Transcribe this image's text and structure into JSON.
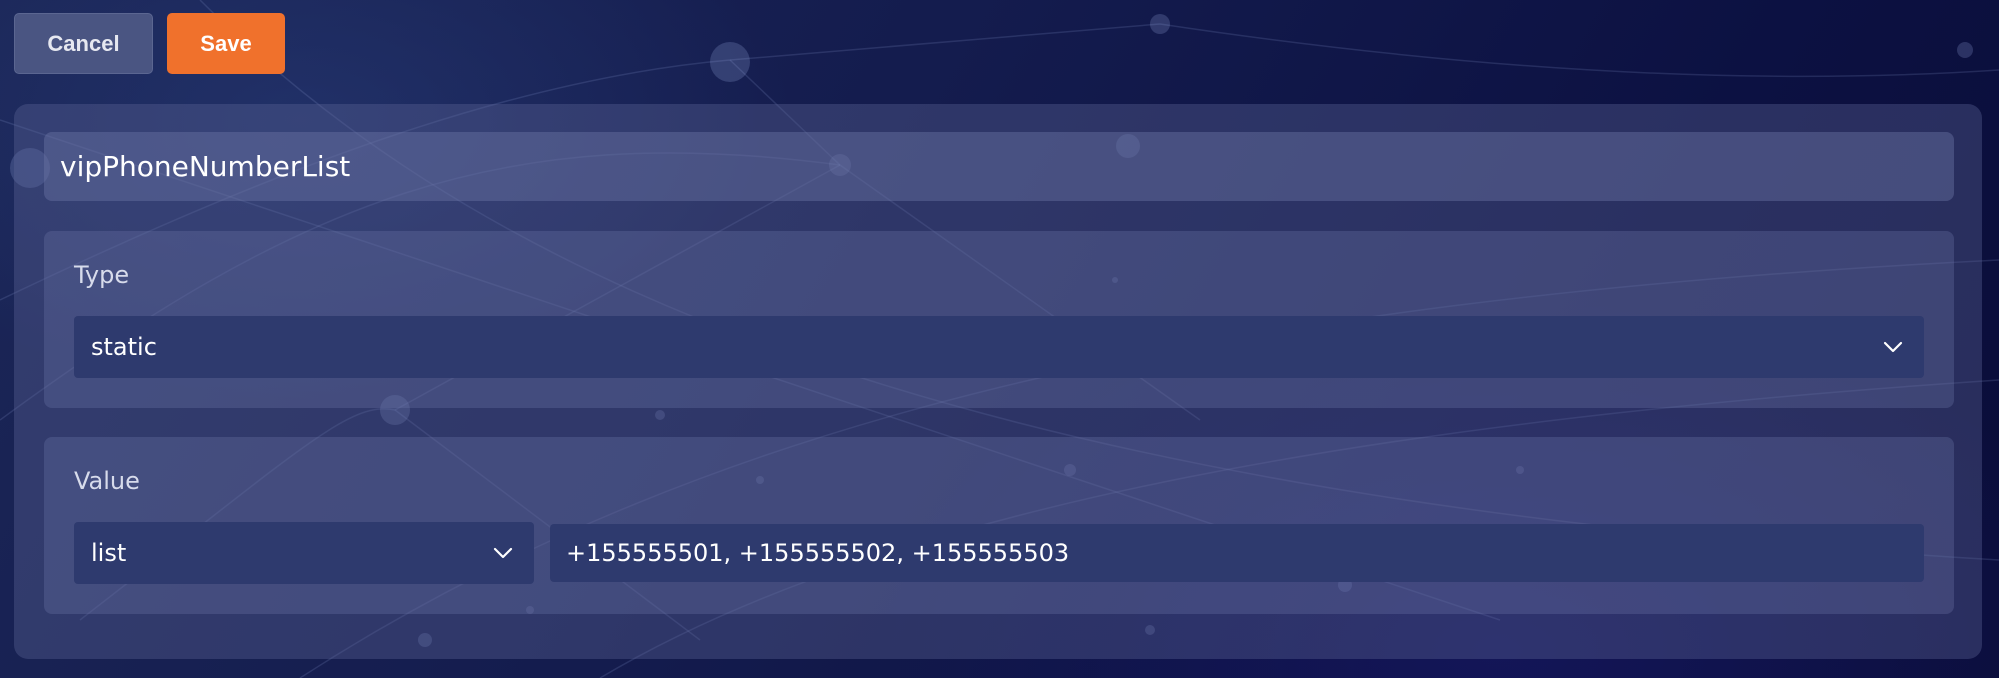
{
  "toolbar": {
    "cancel_label": "Cancel",
    "save_label": "Save"
  },
  "variable": {
    "name": "vipPhoneNumberList"
  },
  "type_section": {
    "label": "Type",
    "selected": "static",
    "chevron_icon": "chevron-down-icon"
  },
  "value_section": {
    "label": "Value",
    "kind_selected": "list",
    "chevron_icon": "chevron-down-icon",
    "input_value": "+155555501, +155555502, +155555503"
  },
  "colors": {
    "accent": "#f0712c",
    "background": "#141c4e",
    "select_bg": "#2e3a6e"
  }
}
